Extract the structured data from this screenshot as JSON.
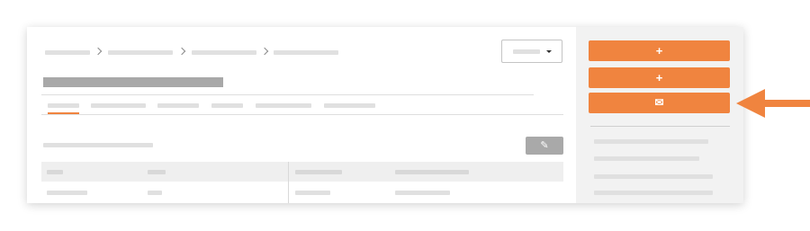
{
  "actions": {
    "add_primary_icon": "+",
    "add_secondary_icon": "+",
    "email_icon": "✉"
  },
  "toolbar": {
    "edit_icon": "✎"
  },
  "icons": [
    "chevron-right-icon",
    "chevron-down-icon",
    "pencil-icon",
    "plus-icon",
    "envelope-icon",
    "arrow-left-icon"
  ],
  "colors": {
    "accent": "#f0843f",
    "placeholder": "#e0e0e0",
    "title_placeholder": "#a8a8a8",
    "sidebar_bg": "#f2f2f2"
  }
}
